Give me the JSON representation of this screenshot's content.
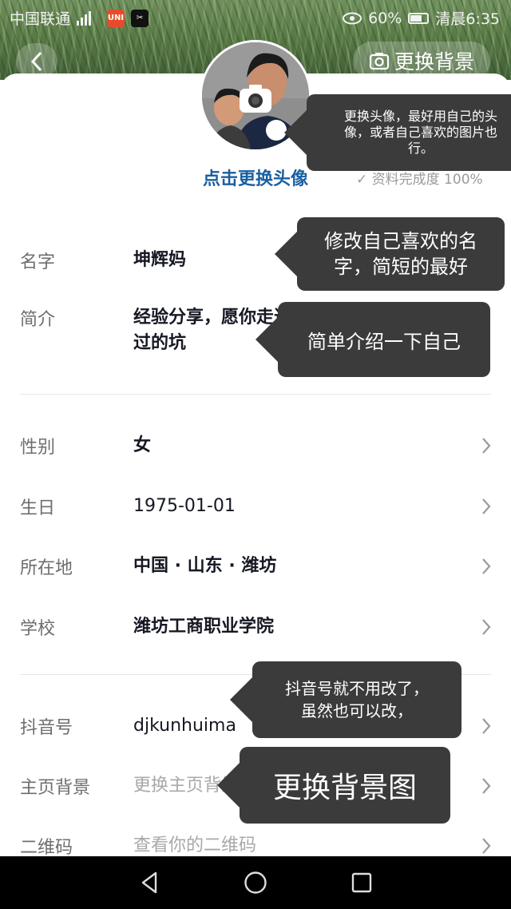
{
  "status_bar": {
    "carrier": "中国联通",
    "app1": "UNI",
    "app2": "✂",
    "battery_pct": "60%",
    "time": "清晨6:35"
  },
  "header": {
    "back_icon": "chevron-left-icon",
    "change_bg_label": "更换背景",
    "completeness": "资料完成度 100%"
  },
  "avatar": {
    "change_label": "点击更换头像"
  },
  "fields": [
    {
      "label": "名字",
      "value": "坤辉妈"
    },
    {
      "label": "简介",
      "value": "经验分享，愿你走过我走过的路，避过我踩过的坑"
    },
    {
      "label": "性别",
      "value": "女"
    },
    {
      "label": "生日",
      "value": "1975-01-01"
    },
    {
      "label": "所在地",
      "value": "中国 · 山东 · 潍坊"
    },
    {
      "label": "学校",
      "value": "潍坊工商职业学院"
    },
    {
      "label": "抖音号",
      "value": "djkunhuima"
    },
    {
      "label": "主页背景",
      "value": "更换主页背景"
    },
    {
      "label": "二维码",
      "value": "查看你的二维码"
    }
  ],
  "callouts": {
    "avatar_tip": "更换头像，最好用自己的头像，或者自己喜欢的图片也行。",
    "name_tip_line1": "修改自己喜欢的名",
    "name_tip_line2": "字，简短的最好",
    "bio_tip": "简单介绍一下自己",
    "id_tip_line1": "抖音号就不用改了，",
    "id_tip_line2": "虽然也可以改，",
    "bg_tip": "更换背景图"
  },
  "colors": {
    "link": "#1a5fa0",
    "callout_bg": "#3b3b3b"
  }
}
